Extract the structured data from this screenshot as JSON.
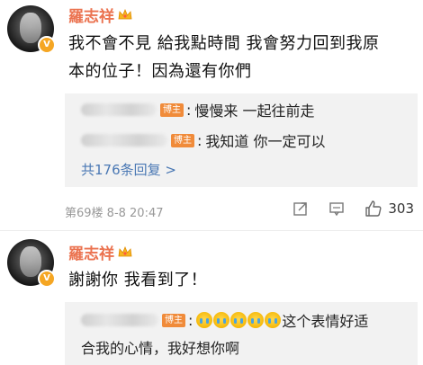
{
  "comments": [
    {
      "username": "羅志祥",
      "content_line1": "我不會不見 給我點時間 我會努力回到我原",
      "content_line2": "本的位子！因為還有你們",
      "replies": [
        {
          "badge": "博主",
          "text": "慢慢来 一起往前走"
        },
        {
          "badge": "博主",
          "text": "我知道 你一定可以"
        }
      ],
      "more_replies": "共176条回复 >",
      "floor_time": "第69楼 8-8 20:47",
      "likes": "303"
    },
    {
      "username": "羅志祥",
      "content_line1": "謝謝你 我看到了！",
      "replies": [
        {
          "badge": "博主",
          "text_line1": "这个表情好适",
          "text_line2": "合我的心情，我好想你啊"
        }
      ]
    }
  ],
  "icons": {
    "verified": "V",
    "crown": "crown-icon",
    "share": "share-icon",
    "comment": "comment-icon",
    "like": "thumbs-up-icon",
    "emoji": "crying-face-icon"
  },
  "colors": {
    "username": "#eb7350",
    "link": "#4a78b4",
    "host_badge": "#f08b3a",
    "reply_bg": "#f2f2f2"
  }
}
